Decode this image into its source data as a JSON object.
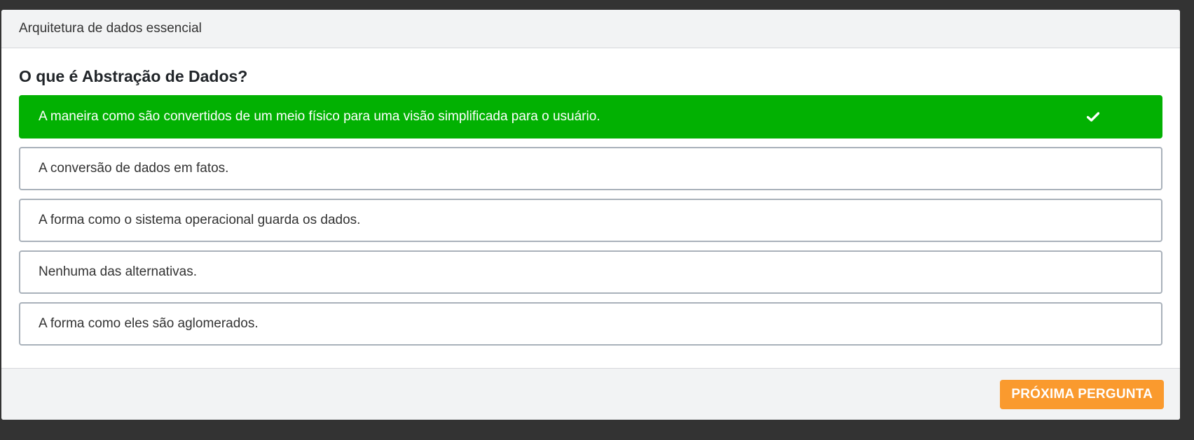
{
  "header": {
    "course_title": "Arquitetura de dados essencial"
  },
  "quiz": {
    "question": "O que é Abstração de Dados?",
    "options": [
      {
        "label": "A maneira como são convertidos de um meio físico para uma visão simplificada para o usuário.",
        "selected": true,
        "icon": "check-icon"
      },
      {
        "label": "A conversão de dados em fatos.",
        "selected": false
      },
      {
        "label": "A forma como o sistema operacional guarda os dados.",
        "selected": false
      },
      {
        "label": "Nenhuma das alternativas.",
        "selected": false
      },
      {
        "label": "A forma como eles são aglomerados.",
        "selected": false
      }
    ]
  },
  "footer": {
    "next_label": "PRÓXIMA PERGUNTA"
  },
  "colors": {
    "selected_option": "#02b102",
    "next_button": "#fa9a2e",
    "page_background": "#333333"
  }
}
